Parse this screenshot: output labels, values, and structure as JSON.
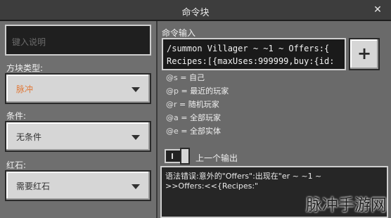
{
  "window": {
    "title": "命令块",
    "close_label": "✕"
  },
  "left": {
    "description_placeholder": "键入说明",
    "block_type_label": "方块类型:",
    "block_type_value": "脉冲",
    "condition_label": "条件:",
    "condition_value": "无条件",
    "redstone_label": "红石:",
    "redstone_value": "需要红石"
  },
  "right": {
    "command_label": "命令输入",
    "command_line_1": "/summon Villager ~ ~1 ~ Offers:{",
    "command_line_2": "Recipes:[{maxUses:999999,buy:{id:",
    "add_button_label": "+",
    "selectors": [
      {
        "code": "@s",
        "sep": " = ",
        "meaning": "自己"
      },
      {
        "code": "@p",
        "sep": " = ",
        "meaning": "最近的玩家"
      },
      {
        "code": "@r",
        "sep": " = ",
        "meaning": "随机玩家"
      },
      {
        "code": "@a",
        "sep": " = ",
        "meaning": "全部玩家"
      },
      {
        "code": "@e",
        "sep": " = ",
        "meaning": "全部实体"
      }
    ],
    "previous_output_label": "上一个输出",
    "output_line_1": "语法错误:意外的\"Offers\":出现在\"er ~ ~1 ~",
    "output_line_2": ">>Offers:<<{Recipes:\""
  },
  "watermark": "脉冲手游网",
  "colors": {
    "accent": "#e07a3a",
    "panel": "#6f6f6f",
    "titlebar": "#3d3d3d"
  }
}
